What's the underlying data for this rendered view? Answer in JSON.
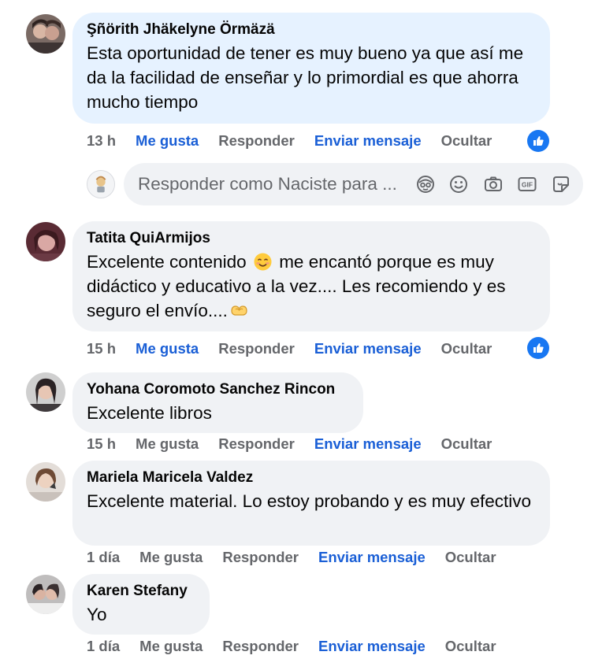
{
  "comments": [
    {
      "author": "Şñörith Jhäkelyne Örmäzä",
      "text": "Esta oportunidad de tener es muy bueno ya que así me da la facilidad de enseñar y lo primordial es que ahorra mucho tiempo",
      "time": "13 h",
      "like": "Me gusta",
      "reply": "Responder",
      "message": "Enviar mensaje",
      "hide": "Ocultar",
      "liked": true,
      "reacted": true
    },
    {
      "author": "Tatita QuiArmijos",
      "text_before": "Excelente contenido",
      "text_after": "me encantó porque es muy didáctico y educativo a la vez.... Les recomiendo y es seguro el envío....",
      "time": "15 h",
      "like": "Me gusta",
      "reply": "Responder",
      "message": "Enviar mensaje",
      "hide": "Ocultar",
      "liked": true,
      "reacted": true
    },
    {
      "author": "Yohana Coromoto Sanchez Rincon",
      "text": "Excelente libros",
      "time": "15 h",
      "like": "Me gusta",
      "reply": "Responder",
      "message": "Enviar mensaje",
      "hide": "Ocultar",
      "liked": false
    },
    {
      "author": "Mariela Maricela Valdez",
      "text": "Excelente material. Lo estoy probando y es muy efectivo",
      "time": "1 día",
      "like": "Me gusta",
      "reply": "Responder",
      "message": "Enviar mensaje",
      "hide": "Ocultar",
      "liked": false
    },
    {
      "author": "Karen Stefany",
      "text": "Yo",
      "time": "1 día",
      "like": "Me gusta",
      "reply": "Responder",
      "message": "Enviar mensaje",
      "hide": "Ocultar",
      "liked": false
    }
  ],
  "reply_box": {
    "placeholder": "Responder como Naciste para ...",
    "icons": [
      "avatar-sticker-icon",
      "emoji-icon",
      "camera-icon",
      "gif-icon",
      "sticker-icon"
    ]
  },
  "colors": {
    "accent_blue": "#1877f2",
    "link_blue": "#1a5fd6",
    "muted_gray": "#65676b",
    "bubble_gray": "#f0f2f5",
    "bubble_highlight": "#e6f2ff"
  }
}
